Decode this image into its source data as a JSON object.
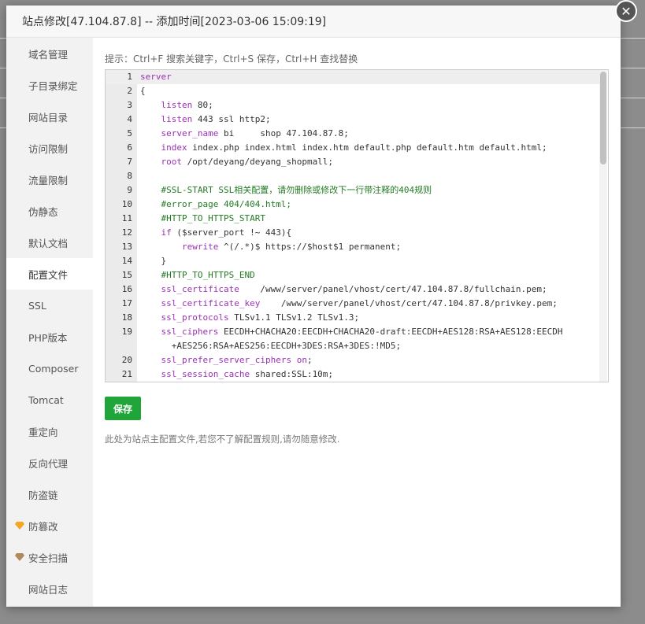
{
  "modal": {
    "title": "站点修改[47.104.87.8] -- 添加时间[2023-03-06 15:09:19]",
    "close_symbol": "✕"
  },
  "sidebar": {
    "items": [
      {
        "label": "域名管理"
      },
      {
        "label": "子目录绑定"
      },
      {
        "label": "网站目录"
      },
      {
        "label": "访问限制"
      },
      {
        "label": "流量限制"
      },
      {
        "label": "伪静态"
      },
      {
        "label": "默认文档"
      },
      {
        "label": "配置文件",
        "active": true
      },
      {
        "label": "SSL"
      },
      {
        "label": "PHP版本"
      },
      {
        "label": "Composer"
      },
      {
        "label": "Tomcat"
      },
      {
        "label": "重定向"
      },
      {
        "label": "反向代理"
      },
      {
        "label": "防盗链"
      },
      {
        "label": "防篡改",
        "icon": "gold-gem-icon"
      },
      {
        "label": "安全扫描",
        "icon": "bronze-gem-icon"
      },
      {
        "label": "网站日志"
      }
    ]
  },
  "hint": "提示：Ctrl+F 搜索关键字，Ctrl+S 保存，Ctrl+H 查找替换",
  "editor": {
    "lines": [
      {
        "n": "1",
        "code": "server"
      },
      {
        "n": "2",
        "code": "{"
      },
      {
        "n": "3",
        "code": "    listen 80;"
      },
      {
        "n": "4",
        "code": "    listen 443 ssl http2;"
      },
      {
        "n": "5",
        "code": "    server_name bi     shop 47.104.87.8;"
      },
      {
        "n": "6",
        "code": "    index index.php index.html index.htm default.php default.htm default.html;"
      },
      {
        "n": "7",
        "code": "    root /opt/deyang/deyang_shopmall;"
      },
      {
        "n": "8",
        "code": ""
      },
      {
        "n": "9",
        "code": "    #SSL-START SSL相关配置，请勿删除或修改下一行带注释的404规则"
      },
      {
        "n": "10",
        "code": "    #error_page 404/404.html;"
      },
      {
        "n": "11",
        "code": "    #HTTP_TO_HTTPS_START"
      },
      {
        "n": "12",
        "code": "    if ($server_port !~ 443){"
      },
      {
        "n": "13",
        "code": "        rewrite ^(/.*)$ https://$host$1 permanent;"
      },
      {
        "n": "14",
        "code": "    }"
      },
      {
        "n": "15",
        "code": "    #HTTP_TO_HTTPS_END"
      },
      {
        "n": "16",
        "code": "    ssl_certificate    /www/server/panel/vhost/cert/47.104.87.8/fullchain.pem;"
      },
      {
        "n": "17",
        "code": "    ssl_certificate_key    /www/server/panel/vhost/cert/47.104.87.8/privkey.pem;"
      },
      {
        "n": "18",
        "code": "    ssl_protocols TLSv1.1 TLSv1.2 TLSv1.3;"
      },
      {
        "n": "19",
        "code": "    ssl_ciphers EECDH+CHACHA20:EECDH+CHACHA20-draft:EECDH+AES128:RSA+AES128:EECDH"
      },
      {
        "n": "",
        "code": "      +AES256:RSA+AES256:EECDH+3DES:RSA+3DES:!MD5;"
      },
      {
        "n": "20",
        "code": "    ssl_prefer_server_ciphers on;"
      },
      {
        "n": "21",
        "code": "    ssl_session_cache shared:SSL:10m;"
      }
    ]
  },
  "save_label": "保存",
  "note": "此处为站点主配置文件,若您不了解配置规则,请勿随意修改.",
  "colors": {
    "accent": "#20a53a",
    "keyword": "#9b30b6",
    "comment": "#237a23"
  }
}
